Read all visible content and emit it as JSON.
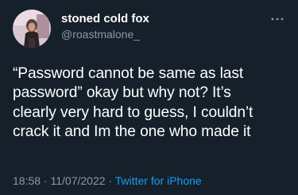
{
  "tweet": {
    "author": {
      "display_name": "stoned cold fox",
      "handle": "@roastmalone_"
    },
    "more_icon": "ellipsis-icon",
    "text": "“Password cannot be same as last\npassword” okay but why not? It’s\nclearly very hard to guess, I couldn’t\ncrack it and Im the one who made it",
    "time": "18:58",
    "separator": "·",
    "date": "11/07/2022",
    "source": "Twitter for iPhone"
  },
  "colors": {
    "background": "#15202b",
    "primary_text": "#ffffff",
    "secondary_text": "#8b98a5",
    "link": "#1d9bf0"
  }
}
